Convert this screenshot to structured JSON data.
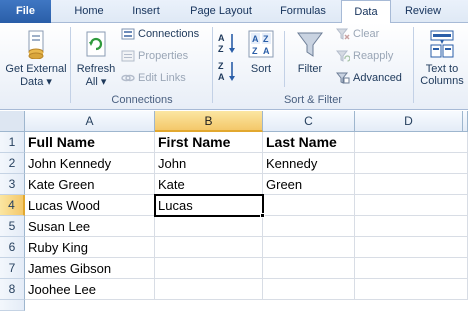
{
  "tabs": {
    "file": "File",
    "home": "Home",
    "insert": "Insert",
    "page_layout": "Page Layout",
    "formulas": "Formulas",
    "data": "Data",
    "review": "Review"
  },
  "ribbon": {
    "get_external_data": {
      "line1": "Get External",
      "line2": "Data ▾"
    },
    "refresh_all": {
      "line1": "Refresh",
      "line2": "All ▾"
    },
    "connections": "Connections",
    "properties": "Properties",
    "edit_links": "Edit Links",
    "group_connections": "Connections",
    "sort": "Sort",
    "filter": "Filter",
    "clear": "Clear",
    "reapply": "Reapply",
    "advanced": "Advanced",
    "group_sort_filter": "Sort & Filter",
    "text_to_columns": {
      "line1": "Text to",
      "line2": "Columns"
    },
    "sort_az_top": "A",
    "sort_az_bottom": "Z",
    "accent": "#2a5ea8"
  },
  "sheet": {
    "columns": [
      "A",
      "B",
      "C",
      "D"
    ],
    "selected_column": "B",
    "selected_row": "4",
    "active_cell": "B4",
    "rows": [
      {
        "num": "1",
        "a": "Full Name",
        "b": "First Name",
        "c": "Last Name"
      },
      {
        "num": "2",
        "a": "John Kennedy",
        "b": "John",
        "c": "Kennedy"
      },
      {
        "num": "3",
        "a": "Kate Green",
        "b": "Kate",
        "c": "Green"
      },
      {
        "num": "4",
        "a": "Lucas Wood",
        "b": "Lucas",
        "c": ""
      },
      {
        "num": "5",
        "a": "Susan Lee",
        "b": "",
        "c": ""
      },
      {
        "num": "6",
        "a": "Ruby King",
        "b": "",
        "c": ""
      },
      {
        "num": "7",
        "a": "James Gibson",
        "b": "",
        "c": ""
      },
      {
        "num": "8",
        "a": "Joohee Lee",
        "b": "",
        "c": ""
      }
    ]
  }
}
